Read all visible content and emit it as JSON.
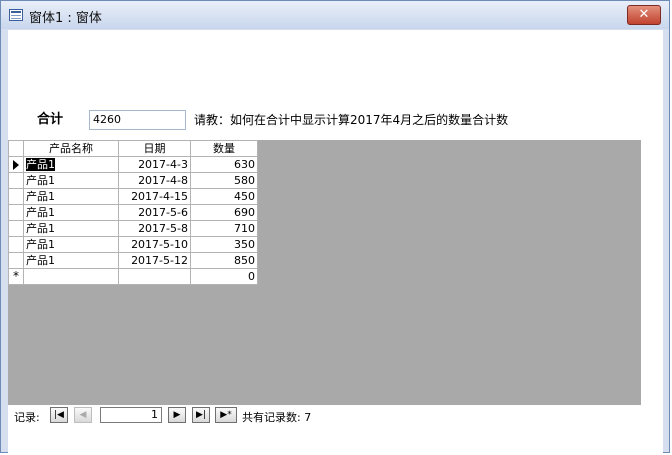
{
  "window": {
    "title": "窗体1 : 窗体",
    "close_symbol": "✕"
  },
  "form": {
    "total_label": "合计",
    "total_value": "4260",
    "question": "请教：如何在合计中显示计算2017年4月之后的数量合计数"
  },
  "table": {
    "columns": [
      "产品名称",
      "日期",
      "数量"
    ],
    "rows": [
      {
        "name": "产品1",
        "date": "2017-4-3",
        "qty": "630"
      },
      {
        "name": "产品1",
        "date": "2017-4-8",
        "qty": "580"
      },
      {
        "name": "产品1",
        "date": "2017-4-15",
        "qty": "450"
      },
      {
        "name": "产品1",
        "date": "2017-5-6",
        "qty": "690"
      },
      {
        "name": "产品1",
        "date": "2017-5-8",
        "qty": "710"
      },
      {
        "name": "产品1",
        "date": "2017-5-10",
        "qty": "350"
      },
      {
        "name": "产品1",
        "date": "2017-5-12",
        "qty": "850"
      }
    ],
    "new_row": {
      "marker": "*",
      "qty": "0"
    }
  },
  "nav": {
    "label": "记录:",
    "first": "|◀",
    "prev": "◀",
    "current": "1",
    "next": "▶",
    "last": "▶|",
    "new": "▶*",
    "count_text": "共有记录数: 7"
  },
  "colors": {
    "datasheet_bg": "#a9a9a9",
    "titlebar": "#c8d6ec",
    "close": "#c0422f"
  },
  "icons": {
    "window": "form-window-icon",
    "current_record": "current-record-arrow-icon"
  }
}
